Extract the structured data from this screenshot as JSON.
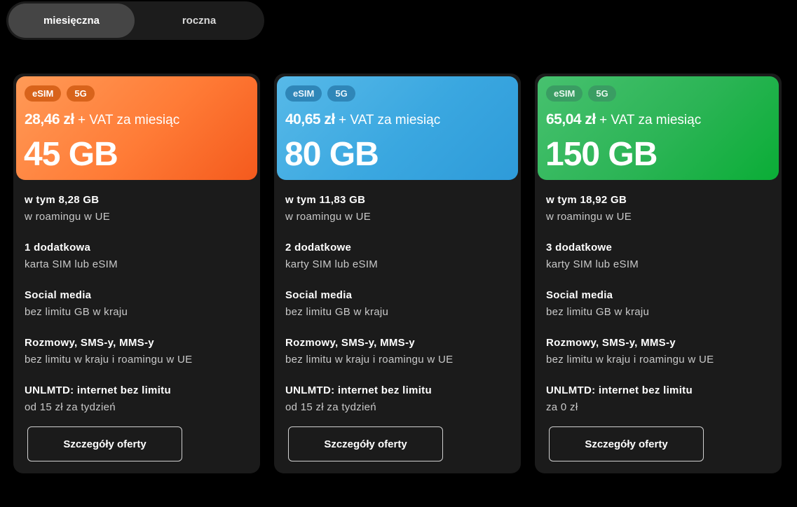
{
  "billing_toggle": {
    "options": [
      "miesięczna",
      "roczna"
    ],
    "selected": "miesięczna"
  },
  "plans": [
    {
      "badges": [
        "eSIM",
        "5G"
      ],
      "price": "28,46 zł",
      "price_suffix": "+ VAT za miesiąc",
      "data": "45 GB",
      "accent_color": "#ff7b36",
      "features": [
        {
          "title": "w tym 8,28 GB",
          "subtitle": "w roamingu w UE"
        },
        {
          "title": "1 dodatkowa",
          "subtitle": "karta SIM lub eSIM"
        },
        {
          "title": "Social media",
          "subtitle": "bez limitu GB w kraju"
        },
        {
          "title": "Rozmowy, SMS-y, MMS-y",
          "subtitle": "bez limitu w kraju i roamingu w UE"
        },
        {
          "title": "UNLMTD: internet bez limitu",
          "subtitle": "od 15 zł za tydzień"
        }
      ],
      "cta_label": "Szczegóły oferty"
    },
    {
      "badges": [
        "eSIM",
        "5G"
      ],
      "price": "40,65 zł",
      "price_suffix": "+ VAT za miesiąc",
      "data": "80 GB",
      "accent_color": "#3aa7e0",
      "features": [
        {
          "title": "w tym 11,83 GB",
          "subtitle": "w roamingu w UE"
        },
        {
          "title": "2 dodatkowe",
          "subtitle": "karty SIM lub eSIM"
        },
        {
          "title": "Social media",
          "subtitle": "bez limitu GB w kraju"
        },
        {
          "title": "Rozmowy, SMS-y, MMS-y",
          "subtitle": "bez limitu w kraju i roamingu w UE"
        },
        {
          "title": "UNLMTD: internet bez limitu",
          "subtitle": "od 15 zł za tydzień"
        }
      ],
      "cta_label": "Szczegóły oferty"
    },
    {
      "badges": [
        "eSIM",
        "5G"
      ],
      "price": "65,04 zł",
      "price_suffix": "+ VAT za miesiąc",
      "data": "150 GB",
      "accent_color": "#2bb455",
      "features": [
        {
          "title": "w tym 18,92 GB",
          "subtitle": "w roamingu w UE"
        },
        {
          "title": "3 dodatkowe",
          "subtitle": "karty SIM lub eSIM"
        },
        {
          "title": "Social media",
          "subtitle": "bez limitu GB w kraju"
        },
        {
          "title": "Rozmowy, SMS-y, MMS-y",
          "subtitle": "bez limitu w kraju i roamingu w UE"
        },
        {
          "title": "UNLMTD: internet bez limitu",
          "subtitle": "za 0 zł"
        }
      ],
      "cta_label": "Szczegóły oferty"
    }
  ]
}
